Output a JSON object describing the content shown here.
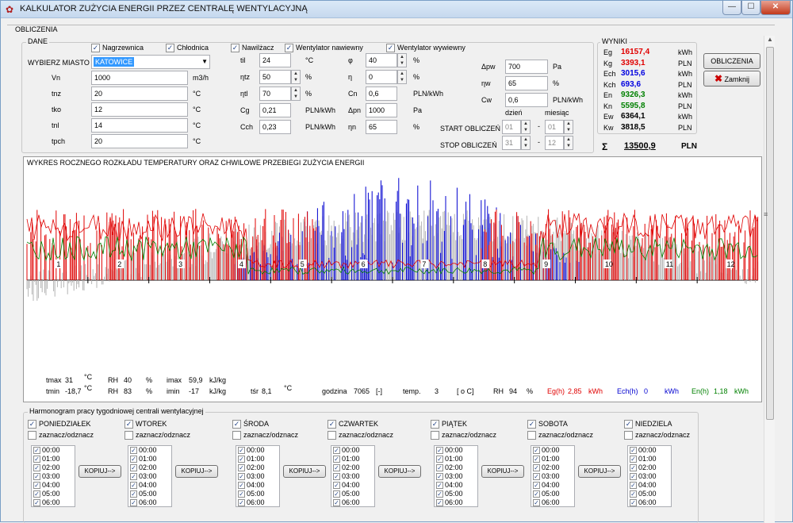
{
  "window": {
    "title": "KALKULATOR ZUŻYCIA ENERGII PRZEZ CENTRALĘ WENTYLACYJNĄ",
    "min": "—",
    "max": "☐",
    "close": "✕"
  },
  "tab": "OBLICZENIA",
  "dane": {
    "label": "DANE",
    "checks": [
      {
        "label": "Nagrzewnica",
        "checked": true
      },
      {
        "label": "Chłodnica",
        "checked": true
      },
      {
        "label": "Nawilżacz",
        "checked": true
      },
      {
        "label": "Wentylator nawiewny",
        "checked": true
      },
      {
        "label": "Wentylator wywiewny",
        "checked": true
      }
    ],
    "city_label": "WYBIERZ MIASTO",
    "city_value": "KATOWICE",
    "col1": [
      {
        "label": "Vn",
        "value": "1000",
        "unit": "m3/h"
      },
      {
        "label": "tnz",
        "value": "20",
        "unit": "°C"
      },
      {
        "label": "tko",
        "value": "12",
        "unit": "°C"
      },
      {
        "label": "tnl",
        "value": "14",
        "unit": "°C"
      },
      {
        "label": "tpch",
        "value": "20",
        "unit": "°C"
      }
    ],
    "col2": [
      {
        "label": "til",
        "value": "24",
        "unit": "°C"
      },
      {
        "label": "ηtz",
        "value": "50",
        "unit": "%"
      },
      {
        "label": "ηtl",
        "value": "70",
        "unit": "%"
      },
      {
        "label": "Cg",
        "value": "0,21",
        "unit": "PLN/kWh"
      },
      {
        "label": "Cch",
        "value": "0,23",
        "unit": "PLN/kWh"
      }
    ],
    "col3": [
      {
        "label": "φ",
        "value": "40",
        "unit": "%"
      },
      {
        "label": "η",
        "value": "0",
        "unit": "%"
      },
      {
        "label": "Cn",
        "value": "0,6",
        "unit": "PLN/kWh"
      },
      {
        "label": "Δpn",
        "value": "1000",
        "unit": "Pa"
      },
      {
        "label": "ηn",
        "value": "65",
        "unit": "%"
      }
    ],
    "col4": [
      {
        "label": "Δpw",
        "value": "700",
        "unit": "Pa"
      },
      {
        "label": "ηw",
        "value": "65",
        "unit": "%"
      },
      {
        "label": "Cw",
        "value": "0,6",
        "unit": "PLN/kWh"
      }
    ],
    "date_headers": {
      "day": "dzień",
      "month": "miesiąc"
    },
    "start": {
      "label": "START OBLICZEŃ",
      "day": "01",
      "month": "01"
    },
    "stop": {
      "label": "STOP OBLICZEŃ",
      "day": "31",
      "month": "12"
    },
    "dash": "-"
  },
  "wyniki": {
    "label": "WYNIKI",
    "rows": [
      {
        "l": "Eg",
        "v": "16157,4",
        "u": "kWh",
        "c": "#e00000"
      },
      {
        "l": "Kg",
        "v": "3393,1",
        "u": "PLN",
        "c": "#e00000"
      },
      {
        "l": "Ech",
        "v": "3015,6",
        "u": "kWh",
        "c": "#0000e0"
      },
      {
        "l": "Kch",
        "v": "693,6",
        "u": "PLN",
        "c": "#0000e0"
      },
      {
        "l": "En",
        "v": "9326,3",
        "u": "kWh",
        "c": "#008000"
      },
      {
        "l": "Kn",
        "v": "5595,8",
        "u": "PLN",
        "c": "#008000"
      },
      {
        "l": "Ew",
        "v": "6364,1",
        "u": "kWh",
        "c": "#000000"
      },
      {
        "l": "Kw",
        "v": "3818,5",
        "u": "PLN",
        "c": "#000000"
      }
    ],
    "sigma": "Σ",
    "total": "13500,9",
    "total_unit": "PLN"
  },
  "buttons": {
    "calc": "OBLICZENIA",
    "close": "Zamknij"
  },
  "chart": {
    "title": "WYKRES ROCZNEGO ROZKŁADU TEMPERATURY ORAZ CHWILOWE PRZEBIEGI ZUŻYCIA ENERGII",
    "months": [
      "1",
      "2",
      "3",
      "4",
      "5",
      "6",
      "7",
      "8",
      "9",
      "10",
      "11",
      "12"
    ]
  },
  "stats": {
    "tmax": "tmax",
    "tmax_v": "31",
    "tmin": "tmin",
    "tmin_v": "-18,7",
    "degc": "°C",
    "rh": "RH",
    "rh1": "40",
    "rh2": "83",
    "pct": "%",
    "imax": "imax",
    "imax_v": "59,9",
    "imin": "imin",
    "imin_v": "-17",
    "kjkg": "kJ/kg",
    "tsr": "tśr",
    "tsr_v": "8,1",
    "godzina": "godzina",
    "godzina_v": "7065",
    "br": "[-]",
    "temp": "temp.",
    "temp_v": "3",
    "oc": "[ o C]",
    "rh3": "94",
    "eg": "Eg(h)",
    "eg_v": "2,85",
    "ech": "Ech(h)",
    "ech_v": "0",
    "en": "En(h)",
    "en_v": "1,18",
    "kwh": "kWh"
  },
  "harm": {
    "label": "Harmonogram pracy tygodniowej centrali wentylacyjnej",
    "days": [
      "PONIEDZIAŁEK",
      "WTOREK",
      "ŚRODA",
      "CZWARTEK",
      "PIĄTEK",
      "SOBOTA",
      "NIEDZIELA"
    ],
    "toggle": "zaznacz/odznacz",
    "hours": [
      "00:00",
      "01:00",
      "02:00",
      "03:00",
      "04:00",
      "05:00",
      "06:00"
    ],
    "copy": "KOPIUJ-->"
  },
  "colors": {
    "heat": "#e00000",
    "cool": "#0000d0",
    "humid": "#008000",
    "temp": "#b4b4b4"
  }
}
